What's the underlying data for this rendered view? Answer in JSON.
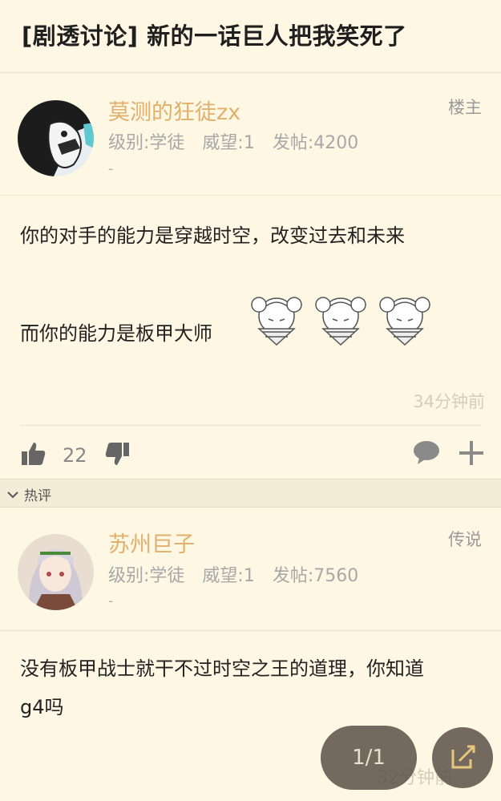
{
  "thread": {
    "title": "[剧透讨论] 新的一话巨人把我笑死了"
  },
  "posts": [
    {
      "username": "莫测的狂徒zx",
      "badge": "楼主",
      "level": "级别:学徒",
      "prestige": "威望:1",
      "post_count": "发帖:4200",
      "signature": "-",
      "content": [
        "你的对手的能力是穿越时空，改变过去和未来",
        "而你的能力是板甲大师"
      ],
      "time": "34分钟前",
      "likes": "22"
    },
    {
      "username": "苏州巨子",
      "badge": "传说",
      "level": "级别:学徒",
      "prestige": "威望:1",
      "post_count": "发帖:7560",
      "signature": "-",
      "content": [
        "没有板甲战士就干不过时空之王的道理，你知道",
        "g4吗"
      ],
      "time": "32分钟前"
    }
  ],
  "section": {
    "label": "热评"
  },
  "pager": {
    "label": "1/1"
  },
  "icons": {
    "like": "thumbs-up-icon",
    "dislike": "thumbs-down-icon",
    "comment": "comment-bubble-icon",
    "add": "plus-icon",
    "collapse": "chevron-down-icon",
    "edit": "edit-icon"
  },
  "colors": {
    "background": "#fdf7e4",
    "username": "#e0b06c",
    "meta": "#a8a8a8",
    "divider": "#ece3c8"
  }
}
